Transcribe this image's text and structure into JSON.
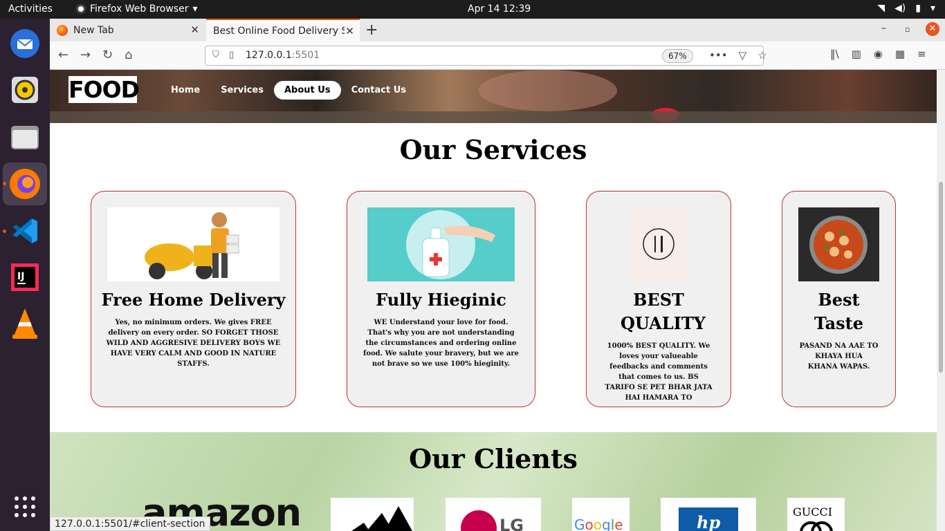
{
  "system": {
    "activities": "Activities",
    "app_name": "Firefox Web Browser",
    "clock": "Apr 14  12:39"
  },
  "browser": {
    "tabs": [
      {
        "label": "New Tab"
      },
      {
        "label": "Best Online Food Delivery S"
      }
    ],
    "url_host": "127.0.0.1",
    "url_port": ":5501",
    "zoom": "67%",
    "status_url": "127.0.0.1:5501/#client-section"
  },
  "site": {
    "logo": "FOOD",
    "nav": [
      "Home",
      "Services",
      "About Us",
      "Contact Us"
    ],
    "services_title": "Our Services",
    "cards": [
      {
        "title": "Free Home Delivery",
        "text": "Yes, no minimum orders. We gives FREE delivery on every order. SO FORGET THOSE WILD AND AGGRESIVE DELIVERY BOYS WE HAVE VERY CALM AND GOOD IN NATURE STAFFS."
      },
      {
        "title": "Fully Hieginic",
        "text": "WE Understand your love for food. That's why you are not understanding the circumstances and ordering online food. We salute your bravery, but we are not brave so we use 100% hieginity."
      },
      {
        "title": "BEST QUALITY",
        "text": "1000% BEST QUALITY. We loves your valueable feedbacks and comments that comes to us. BS TARIFO SE PET BHAR JATA HAI HAMARA TO"
      },
      {
        "title": "Best Taste",
        "text": "PASAND NA AAE TO KHAYA HUA KHANA WAPAS."
      }
    ],
    "clients_title": "Our Clients",
    "client_logos": [
      "amazon",
      "adidas",
      "LG",
      "Google",
      "hp",
      "GUCCI"
    ]
  }
}
